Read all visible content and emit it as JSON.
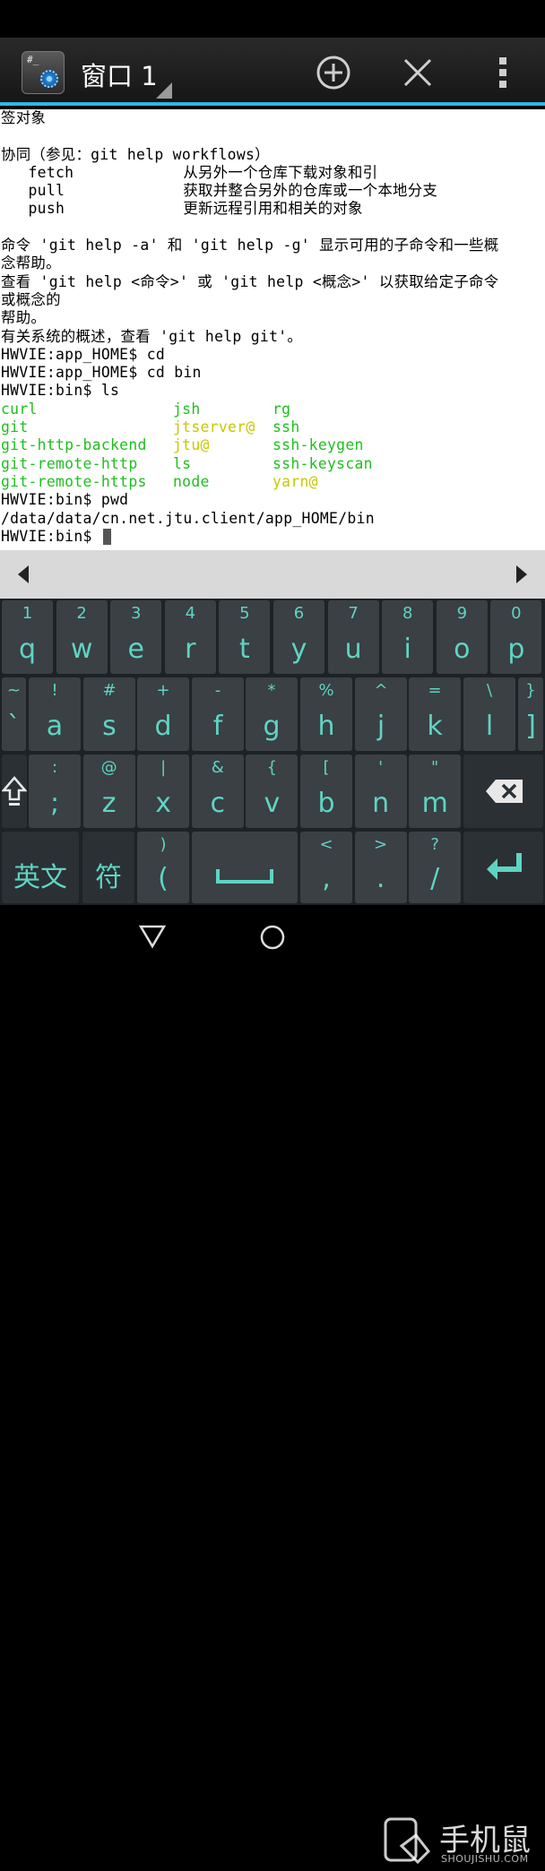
{
  "window": {
    "title": "窗口 1"
  },
  "terminal": {
    "lines": [
      "签对象",
      "",
      "协同（参见：git help workflows）",
      "   fetch            从另外一个仓库下载对象和引",
      "   pull             获取并整合另外的仓库或一个本地分支",
      "   push             更新远程引用和相关的对象",
      "",
      "命令 'git help -a' 和 'git help -g' 显示可用的子命令和一些概",
      "念帮助。",
      "查看 'git help <命令>' 或 'git help <概念>' 以获取给定子命令",
      "或概念的",
      "帮助。",
      "有关系统的概述，查看 'git help git'。",
      "HWVIE:app_HOME$ cd",
      "HWVIE:app_HOME$ cd bin",
      "HWVIE:bin$ ls"
    ],
    "ls_rows": [
      [
        {
          "t": "curl",
          "c": "g"
        },
        {
          "t": "jsh",
          "c": "g"
        },
        {
          "t": "rg",
          "c": "g"
        }
      ],
      [
        {
          "t": "git",
          "c": "g"
        },
        {
          "t": "jtserver@",
          "c": "y"
        },
        {
          "t": "ssh",
          "c": "g"
        }
      ],
      [
        {
          "t": "git-http-backend",
          "c": "g"
        },
        {
          "t": "jtu@",
          "c": "y"
        },
        {
          "t": "ssh-keygen",
          "c": "g"
        }
      ],
      [
        {
          "t": "git-remote-http",
          "c": "g"
        },
        {
          "t": "ls",
          "c": "g"
        },
        {
          "t": "ssh-keyscan",
          "c": "g"
        }
      ],
      [
        {
          "t": "git-remote-https",
          "c": "g"
        },
        {
          "t": "node",
          "c": "g"
        },
        {
          "t": "yarn@",
          "c": "y"
        }
      ]
    ],
    "after_lines": [
      "HWVIE:bin$ pwd",
      "/data/data/cn.net.jtu.client/app_HOME/bin"
    ],
    "prompt": "HWVIE:bin$ "
  },
  "keyboard": {
    "row1": [
      [
        "1",
        "q"
      ],
      [
        "2",
        "w"
      ],
      [
        "3",
        "e"
      ],
      [
        "4",
        "r"
      ],
      [
        "5",
        "t"
      ],
      [
        "6",
        "y"
      ],
      [
        "7",
        "u"
      ],
      [
        "8",
        "i"
      ],
      [
        "9",
        "o"
      ],
      [
        "0",
        "p"
      ]
    ],
    "row2": [
      [
        "~",
        "`"
      ],
      [
        "!",
        "a"
      ],
      [
        "#",
        "s"
      ],
      [
        "+",
        "d"
      ],
      [
        "-",
        "f"
      ],
      [
        "*",
        "g"
      ],
      [
        "%",
        "h"
      ],
      [
        "^",
        "j"
      ],
      [
        "=",
        "k"
      ],
      [
        "\\",
        "l"
      ],
      [
        "}",
        "]"
      ]
    ],
    "row2_tab_hint": "}",
    "row3": [
      [
        ":",
        ";"
      ],
      [
        "@",
        "z"
      ],
      [
        "|",
        "x"
      ],
      [
        "&",
        "c"
      ],
      [
        "{",
        "v"
      ],
      [
        "[",
        "b"
      ],
      [
        "'",
        "n"
      ],
      [
        "\"",
        "m"
      ]
    ],
    "row4_lang": "英文",
    "row4_sym": "符",
    "row4_paren": [
      ")",
      "("
    ],
    "row4_punct": [
      [
        "<",
        ","
      ],
      [
        ">",
        "."
      ],
      [
        "?",
        "/"
      ]
    ]
  },
  "watermark": {
    "main": "手机鼠",
    "sub": "SHOUJISHU.COM"
  },
  "colors": {
    "accent": "#33b5e5",
    "key_text": "#5fd4c3",
    "ls_green": "#1fbf1f",
    "ls_yellow": "#c8c800"
  }
}
